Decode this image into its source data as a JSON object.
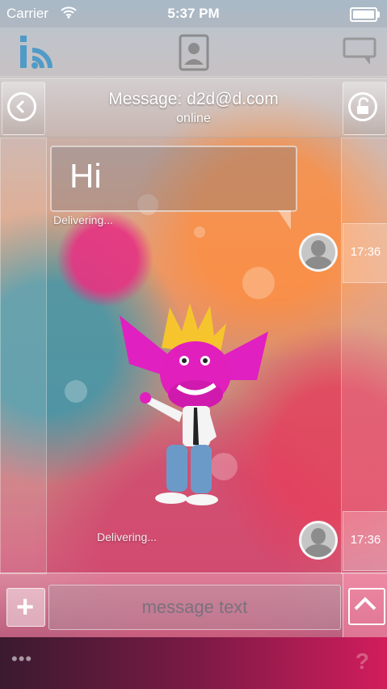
{
  "status_bar": {
    "carrier": "Carrier",
    "time": "5:37 PM"
  },
  "top_bar": {
    "icons": [
      "info-rss-icon",
      "contacts-icon",
      "chat-dropdown-icon"
    ]
  },
  "header": {
    "title": "Message: d2d@d.com",
    "status": "online",
    "icons": [
      "back-arrow-icon",
      "unlock-icon"
    ]
  },
  "messages": [
    {
      "text": "Hi",
      "status": "Delivering...",
      "time": "17:36"
    },
    {
      "sticker": "pink-creature-sticker",
      "status": "Delivering...",
      "time": "17:36"
    }
  ],
  "composer": {
    "placeholder": "message text",
    "icons": [
      "plus-icon",
      "send-up-arrow-icon"
    ]
  },
  "footer": {
    "more": "•••",
    "help": "?"
  }
}
